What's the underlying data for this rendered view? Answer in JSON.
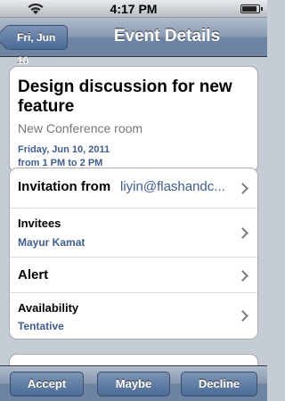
{
  "status_bar": {
    "time": "4:17 PM",
    "battery_level": 0.9
  },
  "nav": {
    "back_label": "Fri, Jun 10",
    "title": "Event Details"
  },
  "event": {
    "title": "Design discussion for new feature",
    "location": "New Conference room",
    "date": "Friday, Jun 10, 2011",
    "time": "from 1 PM to 2 PM"
  },
  "rows": {
    "invitation": {
      "label": "Invitation from",
      "value": "liyin@flashandc..."
    },
    "invitees": {
      "label": "Invitees",
      "value": "Mayur Kamat"
    },
    "alert": {
      "label": "Alert"
    },
    "availability": {
      "label": "Availability",
      "value": "Tentative"
    }
  },
  "toolbar": {
    "accept": "Accept",
    "maybe": "Maybe",
    "decline": "Decline"
  },
  "colors": {
    "nav_blue": "#6d84a2",
    "detail_blue": "#3f5d8e",
    "background": "#c5ccd4"
  }
}
